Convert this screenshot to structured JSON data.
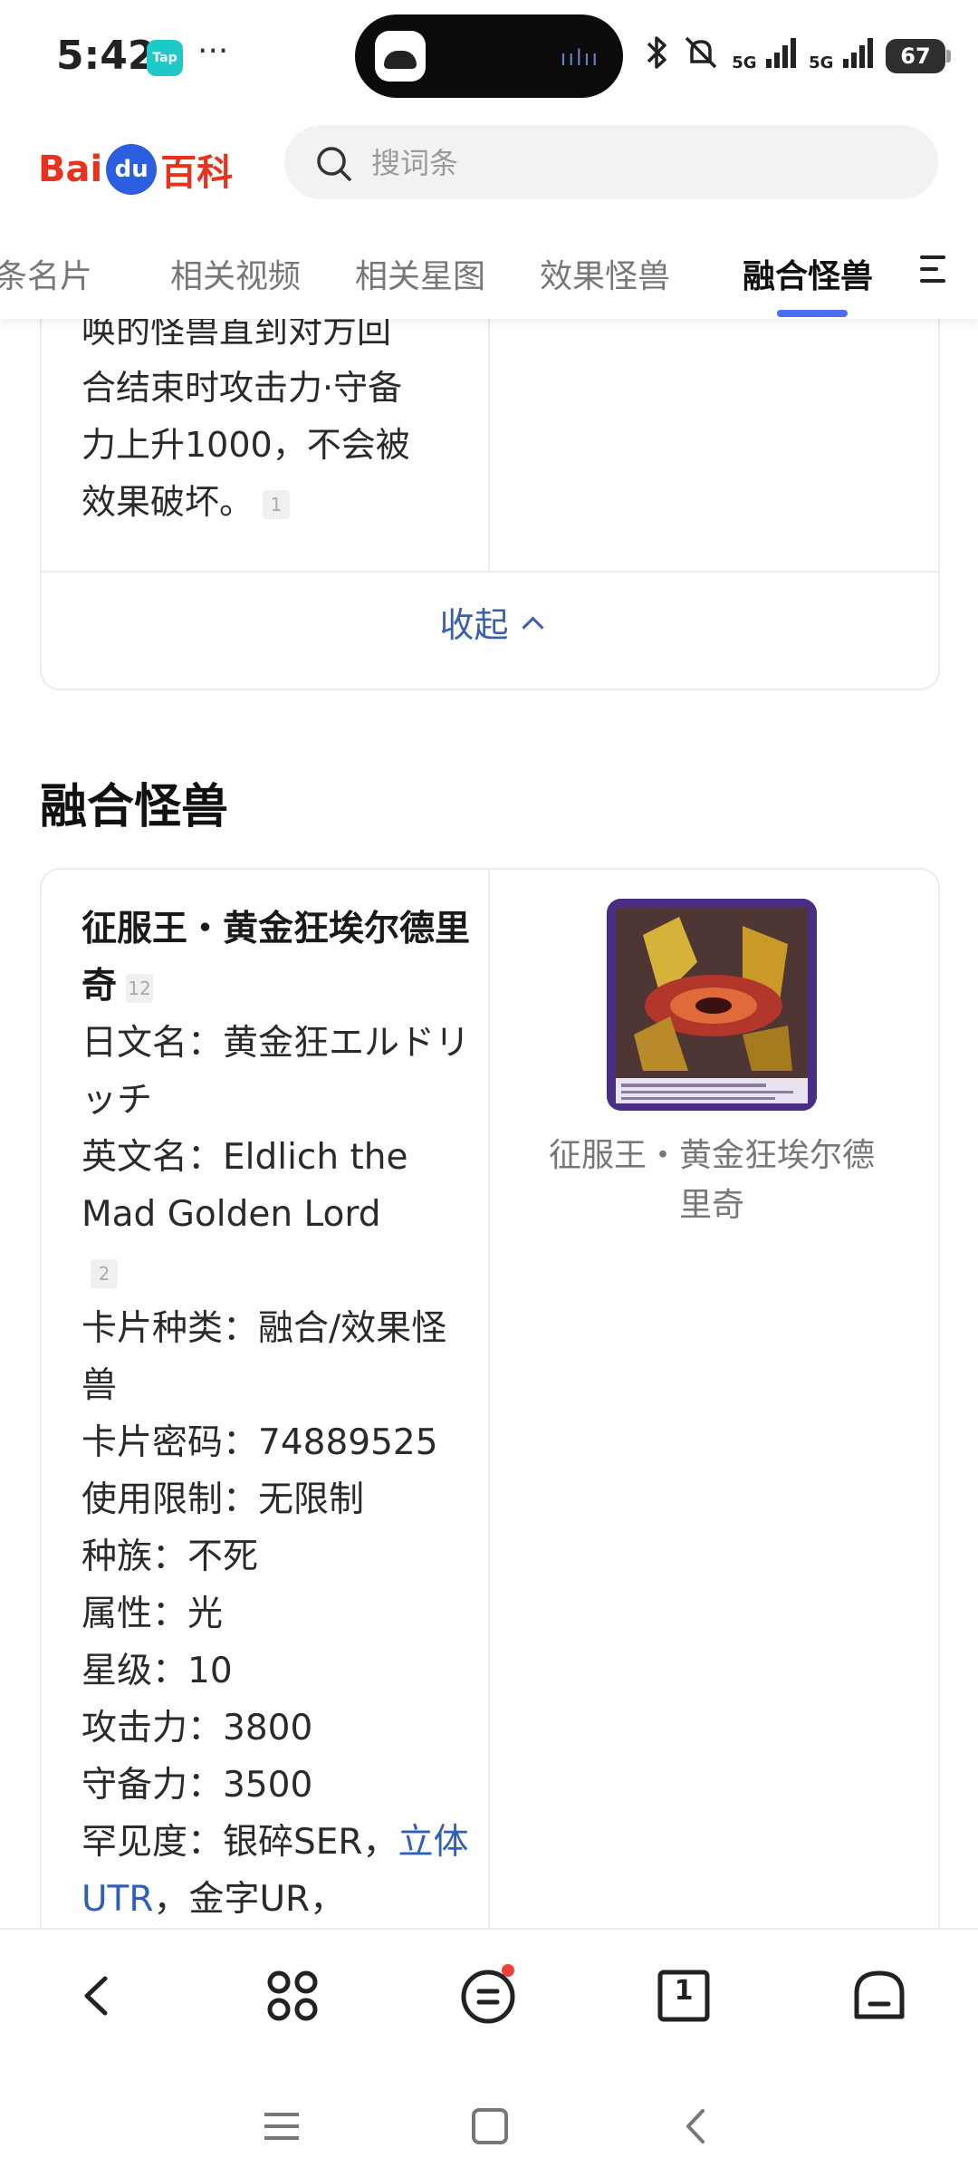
{
  "status_bar": {
    "time": "5:42",
    "tap_badge": "Tap",
    "more": "···",
    "battery": "67",
    "network_a": "5G",
    "network_b": "5G"
  },
  "header": {
    "logo_bai": "Bai",
    "logo_du": "du",
    "logo_baike": "百科",
    "search_placeholder": "搜词条"
  },
  "tabs": [
    "词条名片",
    "相关视频",
    "相关星图",
    "效果怪兽",
    "融合怪兽"
  ],
  "active_tab": 4,
  "card1": {
    "lines": [
      "唤的怪兽直到对方回",
      "合结束时攻击力·守备",
      "力上升1000，不会被",
      "效果破坏。"
    ],
    "ref": "1",
    "collapse_label": "收起"
  },
  "section_title": "融合怪兽",
  "card2": {
    "name": "征服王・黄金狂埃尔德里奇",
    "name_ref": "12",
    "jp_name": "日文名：黄金狂エルドリッチ",
    "en_name": "英文名：Eldlich the Mad Golden Lord",
    "en_ref": "2",
    "card_type": "卡片种类：融合/效果怪兽",
    "password": "卡片密码：74889525",
    "limit": "使用限制：无限制",
    "race": "种族：不死",
    "attribute": "属性：光",
    "level": "星级：10",
    "atk": "攻击力：3800",
    "def": "守备力：3500",
    "rarity_prefix": "罕见度：银碎SER，",
    "rarity_link": "立体UTR",
    "rarity_suffix": "，金字UR，",
    "image_caption": "征服王・黄金狂埃尔德里奇",
    "tab_count": "1"
  }
}
